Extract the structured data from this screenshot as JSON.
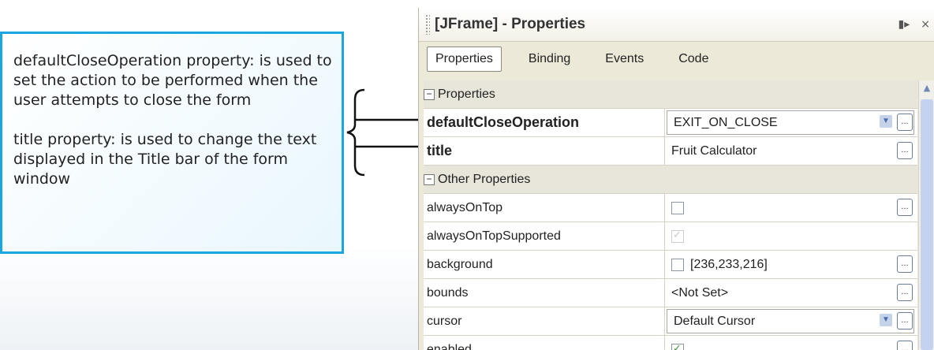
{
  "callout": {
    "p1": "defaultCloseOperation property: is used to set the action to be performed when the user attempts to close the form",
    "p2": "title property: is used to change the text displayed in the Title bar of the form window"
  },
  "window": {
    "title": "[JFrame] - Properties",
    "pin_icon": "pin-icon",
    "close_glyph": "×"
  },
  "tabs": [
    "Properties",
    "Binding",
    "Events",
    "Code"
  ],
  "sections": {
    "properties": "Properties",
    "other": "Other Properties"
  },
  "rows": {
    "defaultCloseOperation": {
      "name": "defaultCloseOperation",
      "value": "EXIT_ON_CLOSE"
    },
    "title": {
      "name": "title",
      "value": "Fruit Calculator"
    },
    "alwaysOnTop": {
      "name": "alwaysOnTop"
    },
    "alwaysOnTopSupported": {
      "name": "alwaysOnTopSupported"
    },
    "background": {
      "name": "background",
      "value": "[236,233,216]"
    },
    "bounds": {
      "name": "bounds",
      "value": "<Not Set>"
    },
    "cursor": {
      "name": "cursor",
      "value": "Default Cursor"
    },
    "enabled": {
      "name": "enabled"
    }
  },
  "ellipsis": "...",
  "colors": {
    "callout_border": "#1aa7df",
    "panel_bg": "#ece9d8"
  }
}
